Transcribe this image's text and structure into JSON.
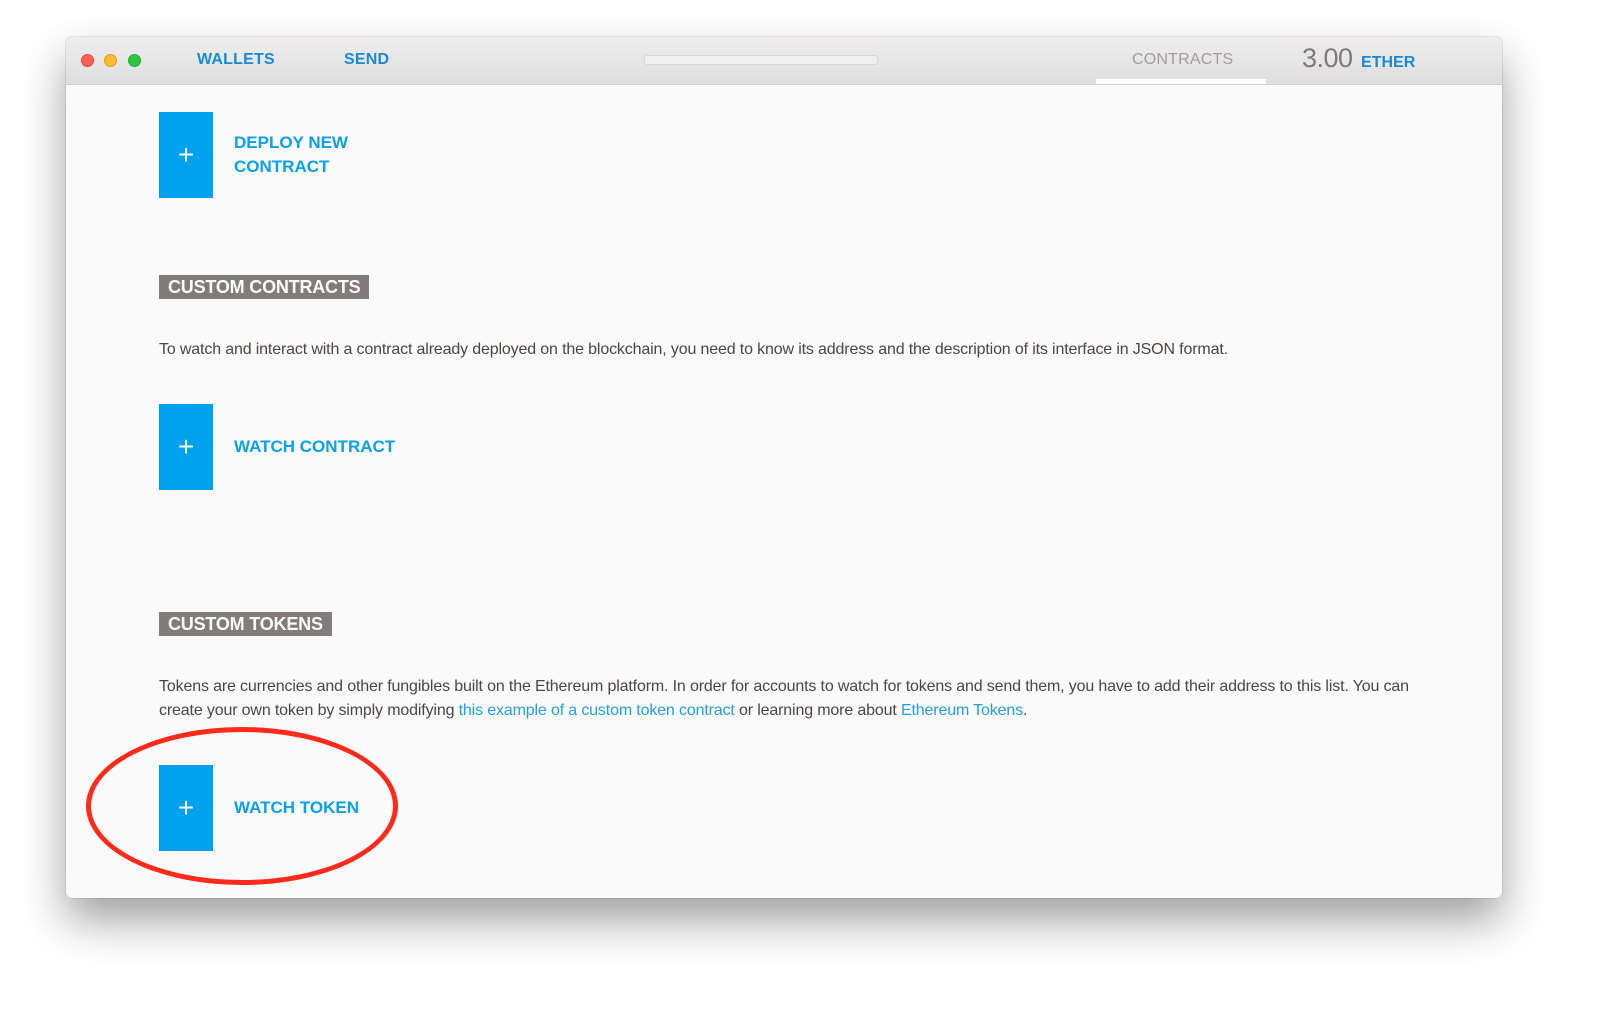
{
  "window": {
    "controls": [
      "close",
      "minimize",
      "zoom"
    ]
  },
  "nav": {
    "wallets_label": "WALLETS",
    "send_label": "SEND",
    "contracts_label": "CONTRACTS",
    "active_tab": "CONTRACTS"
  },
  "balance": {
    "amount": "3.00",
    "unit": "ETHER"
  },
  "actions": {
    "deploy_icon": "+",
    "deploy_label_line1": "DEPLOY NEW",
    "deploy_label_line2": "CONTRACT",
    "watch_contract_icon": "+",
    "watch_contract_label": "WATCH CONTRACT",
    "watch_token_icon": "+",
    "watch_token_label": "WATCH TOKEN"
  },
  "sections": {
    "custom_contracts": {
      "title": "CUSTOM CONTRACTS",
      "description": "To watch and interact with a contract already deployed on the blockchain, you need to know its address and the description of its interface in JSON format."
    },
    "custom_tokens": {
      "title": "CUSTOM TOKENS",
      "description_part1": "Tokens are currencies and other fungibles built on the Ethereum platform. In order for accounts to watch for tokens and send them, you have to add their address to this list. You can create your own token by simply modifying ",
      "link1": "this example of a custom token contract",
      "description_part2": " or learning more about ",
      "link2": "Ethereum Tokens",
      "description_part3": "."
    }
  },
  "colors": {
    "accent_blue": "#00a2ee",
    "link_blue": "#1a8ad0",
    "badge_gray": "#817b7b",
    "annotation_red": "#ff2a1a"
  },
  "annotation": {
    "type": "highlight-ellipse",
    "target": "watch-token-button"
  }
}
